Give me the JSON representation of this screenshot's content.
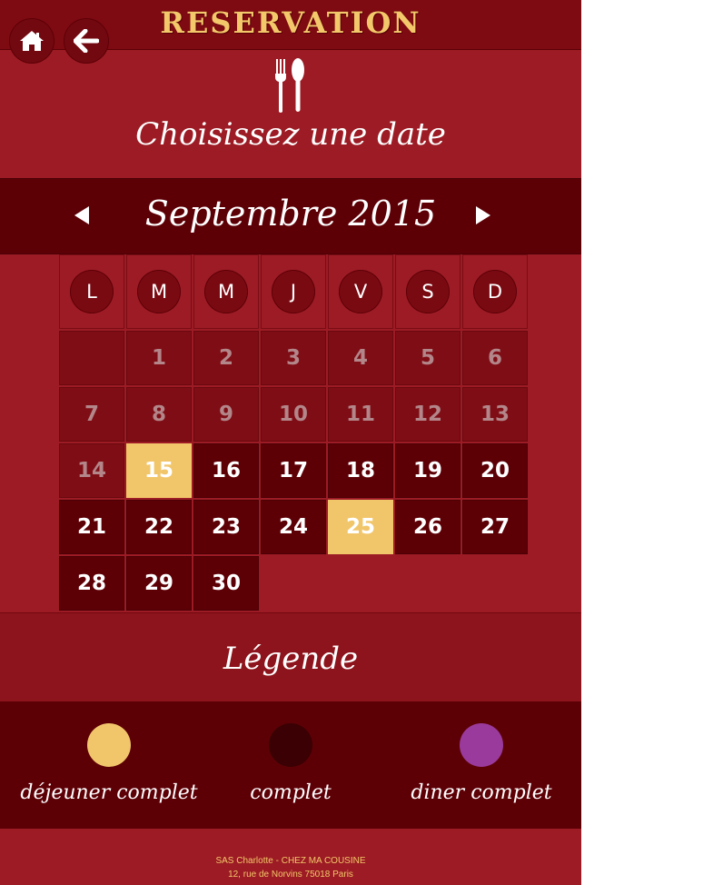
{
  "header": {
    "title": "RESERVATION",
    "home_icon": "home-icon",
    "back_icon": "back-arrow-icon"
  },
  "intro": {
    "icon": "cutlery-icon",
    "prompt": "Choisissez une date"
  },
  "calendar": {
    "month_label": "Septembre 2015",
    "prev_icon": "triangle-left-icon",
    "next_icon": "triangle-right-icon",
    "weekdays": [
      "L",
      "M",
      "M",
      "J",
      "V",
      "S",
      "D"
    ],
    "weeks": [
      [
        {
          "day": "",
          "state": "blank"
        },
        {
          "day": "1",
          "state": "past"
        },
        {
          "day": "2",
          "state": "past"
        },
        {
          "day": "3",
          "state": "past"
        },
        {
          "day": "4",
          "state": "past"
        },
        {
          "day": "5",
          "state": "past"
        },
        {
          "day": "6",
          "state": "past"
        }
      ],
      [
        {
          "day": "7",
          "state": "past"
        },
        {
          "day": "8",
          "state": "past"
        },
        {
          "day": "9",
          "state": "past"
        },
        {
          "day": "10",
          "state": "past"
        },
        {
          "day": "11",
          "state": "past"
        },
        {
          "day": "12",
          "state": "past"
        },
        {
          "day": "13",
          "state": "past"
        }
      ],
      [
        {
          "day": "14",
          "state": "past"
        },
        {
          "day": "15",
          "state": "lunch-full"
        },
        {
          "day": "16",
          "state": "open"
        },
        {
          "day": "17",
          "state": "open"
        },
        {
          "day": "18",
          "state": "open"
        },
        {
          "day": "19",
          "state": "open"
        },
        {
          "day": "20",
          "state": "open"
        }
      ],
      [
        {
          "day": "21",
          "state": "open"
        },
        {
          "day": "22",
          "state": "open"
        },
        {
          "day": "23",
          "state": "open"
        },
        {
          "day": "24",
          "state": "open"
        },
        {
          "day": "25",
          "state": "lunch-full"
        },
        {
          "day": "26",
          "state": "open"
        },
        {
          "day": "27",
          "state": "open"
        }
      ],
      [
        {
          "day": "28",
          "state": "open"
        },
        {
          "day": "29",
          "state": "open"
        },
        {
          "day": "30",
          "state": "open"
        },
        {
          "day": "",
          "state": "none"
        },
        {
          "day": "",
          "state": "none"
        },
        {
          "day": "",
          "state": "none"
        },
        {
          "day": "",
          "state": "none"
        }
      ]
    ]
  },
  "legend": {
    "title": "Légende",
    "items": [
      {
        "label": "déjeuner complet",
        "color": "#f1c66b"
      },
      {
        "label": "complet",
        "color": "#3a0003"
      },
      {
        "label": "diner complet",
        "color": "#9a3a9c"
      }
    ]
  },
  "footer": {
    "line1": "SAS Charlotte - CHEZ MA COUSINE",
    "line2": "12, rue de Norvins 75018 Paris"
  },
  "colors": {
    "background": "#9c1b24",
    "dark": "#5d0006",
    "accent_gold": "#f3c86a"
  }
}
